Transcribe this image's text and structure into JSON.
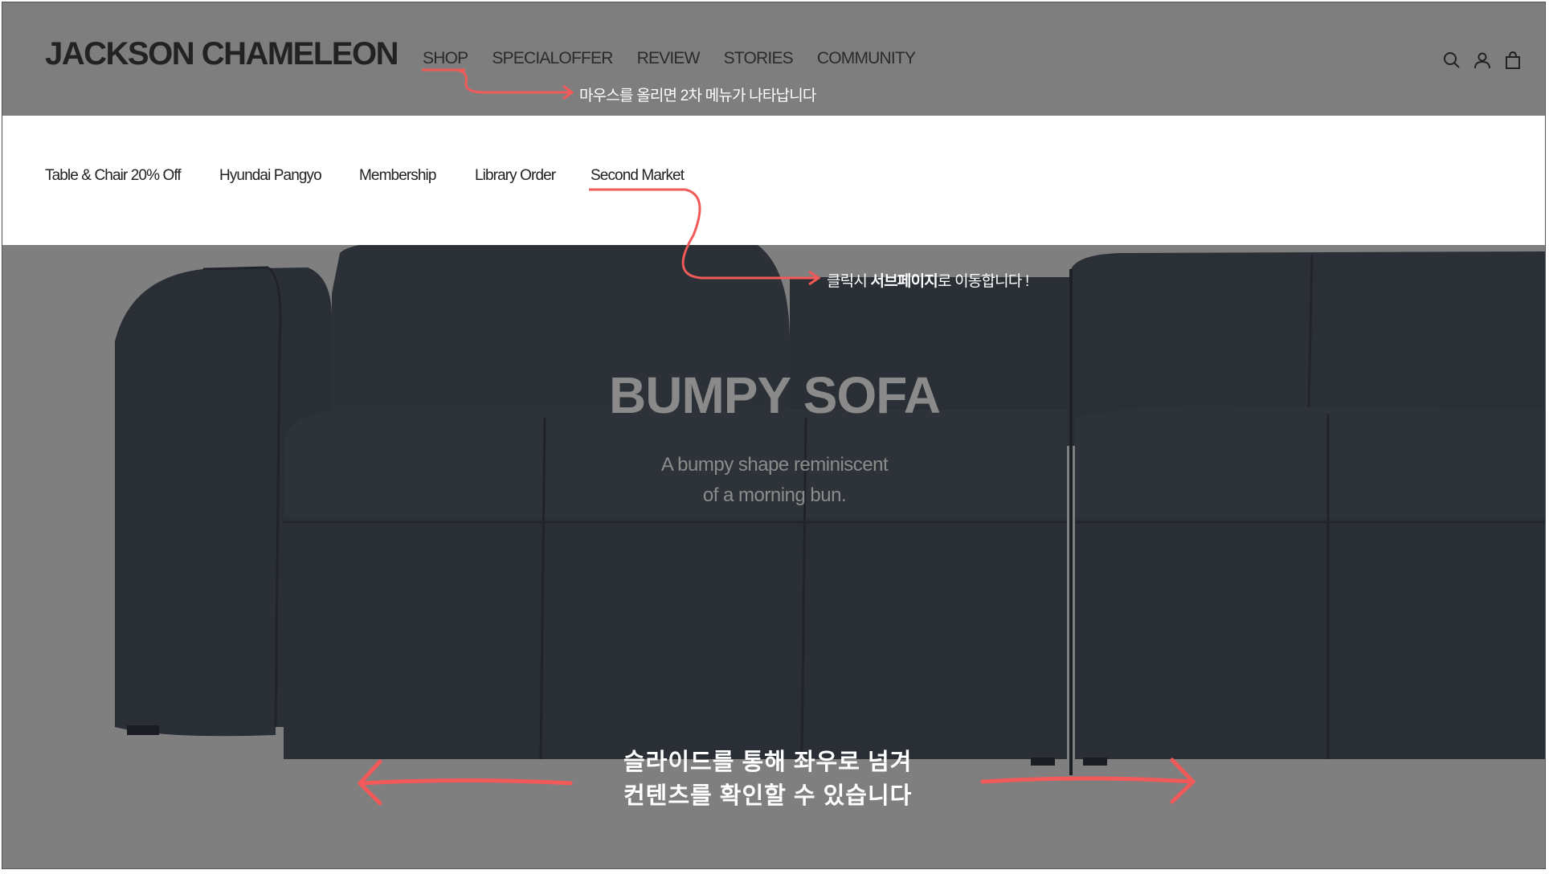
{
  "header": {
    "logo": "JACKSON CHAMELEON",
    "nav": [
      "SHOP",
      "SPECIALOFFER",
      "REVIEW",
      "STORIES",
      "COMMUNITY"
    ],
    "icons": [
      "search-icon",
      "user-icon",
      "bag-icon"
    ]
  },
  "submenu": {
    "items": [
      "Table & Chair 20% Off",
      "Hyundai Pangyo",
      "Membership",
      "Library Order",
      "Second Market"
    ]
  },
  "hero": {
    "title": "BUMPY SOFA",
    "subtitle_line1": "A bumpy shape reminiscent",
    "subtitle_line2": "of a morning bun."
  },
  "annotations": {
    "hover_note": "마우스를 올리면 2차 메뉴가 나타납니다",
    "click_note_prefix": "클릭시 ",
    "click_note_bold": "서브페이지",
    "click_note_suffix": "로 이동합니다 !",
    "slide_line1": "슬라이드를 통해 좌우로 넘겨",
    "slide_line2": "컨텐츠를 확인할 수 있습니다"
  },
  "colors": {
    "overlay_gray": "#7f7f7f",
    "annotation_red": "#f25a5a",
    "sofa_dark": "#2a2f36"
  }
}
